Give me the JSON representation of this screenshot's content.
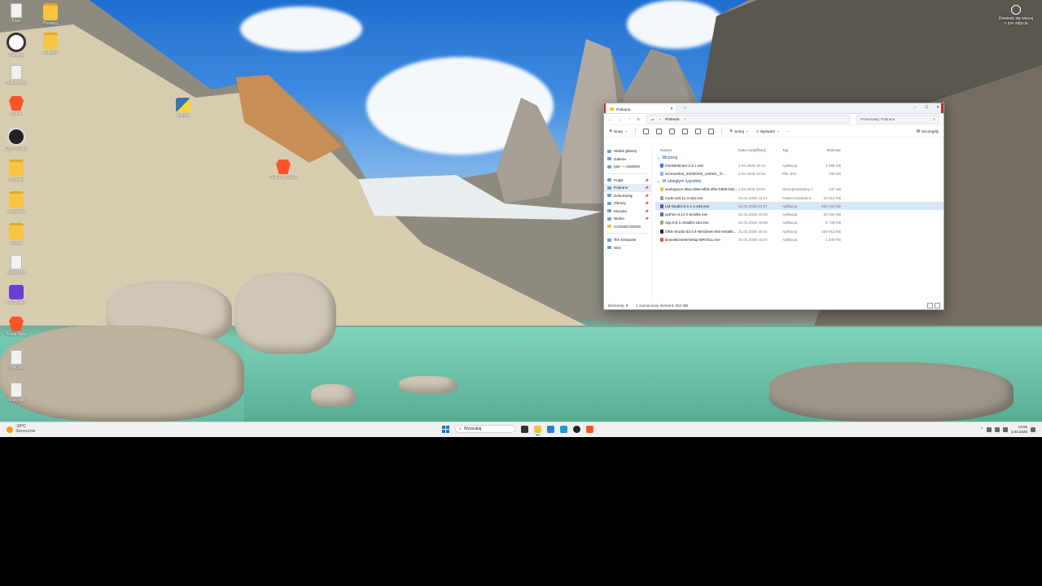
{
  "desktop": {
    "icons": [
      {
        "label": "Kosz",
        "type": "recycle"
      },
      {
        "label": "Przełącz",
        "type": "folder"
      },
      {
        "label": "Kamera",
        "type": "cam"
      },
      {
        "label": "Pobrane",
        "type": "folder"
      },
      {
        "label": "Dokumenty",
        "type": "file"
      },
      {
        "label": "Brave",
        "type": "brave"
      },
      {
        "label": "OBS Studio",
        "type": "obs"
      },
      {
        "label": "Projekty",
        "type": "folder"
      },
      {
        "label": "Aplikacje",
        "type": "folder"
      },
      {
        "label": "Folder",
        "type": "folder"
      },
      {
        "label": "Notatki.txt",
        "type": "file"
      },
      {
        "label": "LM Studio",
        "type": "purple"
      },
      {
        "label": "Brave Beta",
        "type": "brave"
      },
      {
        "label": "Plik.txt",
        "type": "file"
      },
      {
        "label": "Nowy plik",
        "type": "file"
      },
      {
        "label": "python",
        "type": "python"
      },
      {
        "label": "TEN PLIK.EXE",
        "type": "brave"
      }
    ],
    "widget": {
      "line1": "Dowiedz się więcej",
      "line2": "o tym zdjęciu"
    }
  },
  "explorer": {
    "tab_title": "Pobrane",
    "new_tab": "+",
    "controls": [
      "–",
      "☐",
      "✕"
    ],
    "address": {
      "crumb": "Pobrane",
      "chevron": "›"
    },
    "search_placeholder": "Przeszukaj: Pobrane",
    "toolbar": {
      "new": "Nowy",
      "sort": "Sortuj",
      "view": "Wyświetl",
      "more": "···",
      "details": "Szczegóły"
    },
    "nav": [
      {
        "label": "Widok główny",
        "pin": false
      },
      {
        "label": "Galeria",
        "pin": false
      },
      {
        "label": "Igor — osobiste",
        "pin": false
      },
      {
        "label": "Pulpit",
        "pin": true
      },
      {
        "label": "Pobrane",
        "pin": true
      },
      {
        "label": "Dokumenty",
        "pin": true
      },
      {
        "label": "Obrazy",
        "pin": true
      },
      {
        "label": "Muzyka",
        "pin": true
      },
      {
        "label": "Wideo",
        "pin": true
      },
      {
        "label": "COSMICODING",
        "pin": false
      },
      {
        "label": "Ten komputer",
        "pin": false
      },
      {
        "label": "Sieć",
        "pin": false
      }
    ],
    "columns": {
      "name": "Nazwa",
      "date": "Data modyfikacji",
      "type": "Typ",
      "size": "Rozmiar"
    },
    "groups": [
      {
        "label": "Wczoraj",
        "files": [
          {
            "name": "IriunWebcam-2.8.1.exe",
            "date": "2.02.2026 18:13",
            "type": "Aplikacja",
            "size": "4 396 KB"
          },
          {
            "name": "Screenshot_20260202_144941_Tr...",
            "date": "2.02.2026 14:52",
            "type": "Plik JPG",
            "size": "290 KB"
          }
        ]
      },
      {
        "label": "W ubiegłym tygodniu",
        "files": [
          {
            "name": "workspace-35ec196e-8f0d-4f0e-b600-b52...",
            "date": "1.02.2026 20:01",
            "type": "Skompresowany f...",
            "size": "137 KB"
          },
          {
            "name": "node-v20.11.0-x64.msi",
            "date": "31.01.2026 23:17",
            "type": "Pakiet Instalatora ...",
            "size": "26 012 KB"
          },
          {
            "name": "LM-Studio-0.4.1-1-x64.exe",
            "date": "31.01.2026 22:57",
            "type": "Aplikacja",
            "size": "566 152 KB"
          },
          {
            "name": "python-3.14.2-amd64.exe",
            "date": "31.01.2026 20:25",
            "type": "Aplikacja",
            "size": "29 160 KB"
          },
          {
            "name": "npp.8.8.1.Installer.x64.exe",
            "date": "31.01.2026 18:48",
            "type": "Aplikacja",
            "size": "6 728 KB"
          },
          {
            "name": "OBS-Studio-32.0.4-Windows-x64-Installe...",
            "date": "31.01.2026 18:42",
            "type": "Aplikacja",
            "size": "153 913 KB"
          },
          {
            "name": "BraveBrowserSetup-BRV011.exe",
            "date": "31.01.2026 18:37",
            "type": "Aplikacja",
            "size": "1 240 KB"
          }
        ]
      }
    ],
    "status": {
      "count": "Elementy: 9",
      "selected": "1 zaznaczony element: 552 MB"
    }
  },
  "taskbar": {
    "weather_temp": "-10°C",
    "weather_desc": "Słonecznie",
    "search_placeholder": "Wyszukaj",
    "time": "13:06",
    "date": "3.02.2026"
  }
}
